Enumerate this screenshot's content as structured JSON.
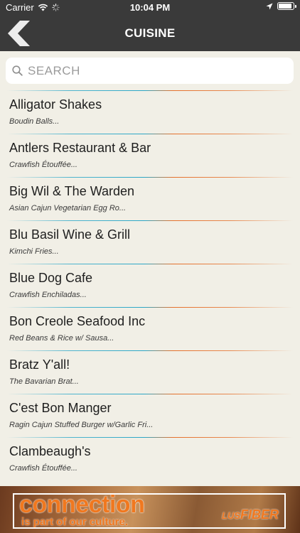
{
  "status_bar": {
    "carrier": "Carrier",
    "time": "10:04 PM",
    "battery_level": 0.9
  },
  "nav": {
    "title": "CUISINE",
    "back_icon": "chevron-left-icon"
  },
  "search": {
    "placeholder": "SEARCH",
    "value": "",
    "icon": "search-icon"
  },
  "restaurants": [
    {
      "name": "Alligator Shakes",
      "dish": "Boudin Balls..."
    },
    {
      "name": "Antlers Restaurant & Bar",
      "dish": "Crawfish Étouffée..."
    },
    {
      "name": "Big Wil & The Warden",
      "dish": "Asian Cajun Vegetarian Egg Ro..."
    },
    {
      "name": "Blu Basil Wine & Grill",
      "dish": "Kimchi Fries..."
    },
    {
      "name": "Blue Dog Cafe",
      "dish": "Crawfish Enchiladas..."
    },
    {
      "name": "Bon Creole Seafood Inc",
      "dish": "Red Beans & Rice w/ Sausa..."
    },
    {
      "name": "Bratz Y'all!",
      "dish": "The Bavarian Brat..."
    },
    {
      "name": "C'est Bon Manger",
      "dish": "Ragin Cajun Stuffed Burger w/Garlic Fri..."
    },
    {
      "name": "Clambeaugh's",
      "dish": "Crawfish Étouffée..."
    }
  ],
  "ad": {
    "headline": "connection",
    "tagline": "is part of our culture.",
    "brand_prefix": "LUS",
    "brand_suffix": "FIBER"
  },
  "colors": {
    "nav_background": "#3a3a3a",
    "page_background": "#f1efe6",
    "divider_blue": "#2aa6c6",
    "divider_orange": "#e5702b",
    "ad_orange": "#f0781f"
  }
}
